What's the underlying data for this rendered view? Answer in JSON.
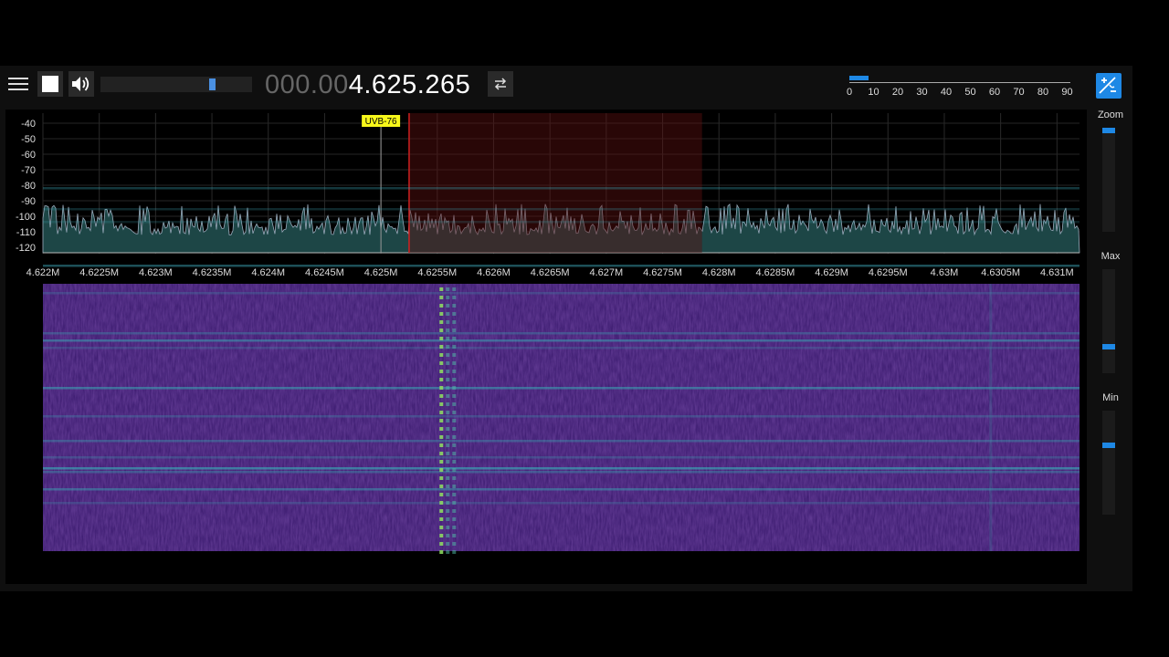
{
  "toolbar": {
    "menu_icon": "hamburger-menu-icon",
    "stop_icon": "stop-square-icon",
    "volume_icon": "speaker-volume-icon",
    "volume_level": 0.75,
    "frequency_dim": "000.00",
    "frequency_bright": "4.625.265",
    "swap_icon": "swap-arrows-icon",
    "controls_icon": "audio-settings-icon"
  },
  "snr_meter": {
    "ticks": [
      "0",
      "10",
      "20",
      "30",
      "40",
      "50",
      "60",
      "70",
      "80",
      "90"
    ],
    "value": 8
  },
  "spectrum": {
    "marker_label": "UVB-76",
    "marker_freq": 4.625,
    "band_start": 4.62525,
    "band_end": 4.62785,
    "db_ticks": [
      "-40",
      "-50",
      "-60",
      "-70",
      "-80",
      "-90",
      "-100",
      "-110",
      "-120"
    ],
    "freq_ticks": [
      "4.622M",
      "4.6225M",
      "4.623M",
      "4.6235M",
      "4.624M",
      "4.6245M",
      "4.625M",
      "4.6255M",
      "4.626M",
      "4.6265M",
      "4.627M",
      "4.6275M",
      "4.628M",
      "4.6285M",
      "4.629M",
      "4.6295M",
      "4.63M",
      "4.6305M",
      "4.631M"
    ]
  },
  "side_panel": {
    "zoom_label": "Zoom",
    "zoom_level": 1.0,
    "max_label": "Max",
    "max_level": 0.24,
    "min_label": "Min",
    "min_level": 0.68
  },
  "colors": {
    "accent": "#1e88e5",
    "spectrum_fill": "#1f4b4b",
    "waterfall_base": "#3a1a6e",
    "band_overlay": "#3a0d0d",
    "marker": "#ffff33"
  }
}
